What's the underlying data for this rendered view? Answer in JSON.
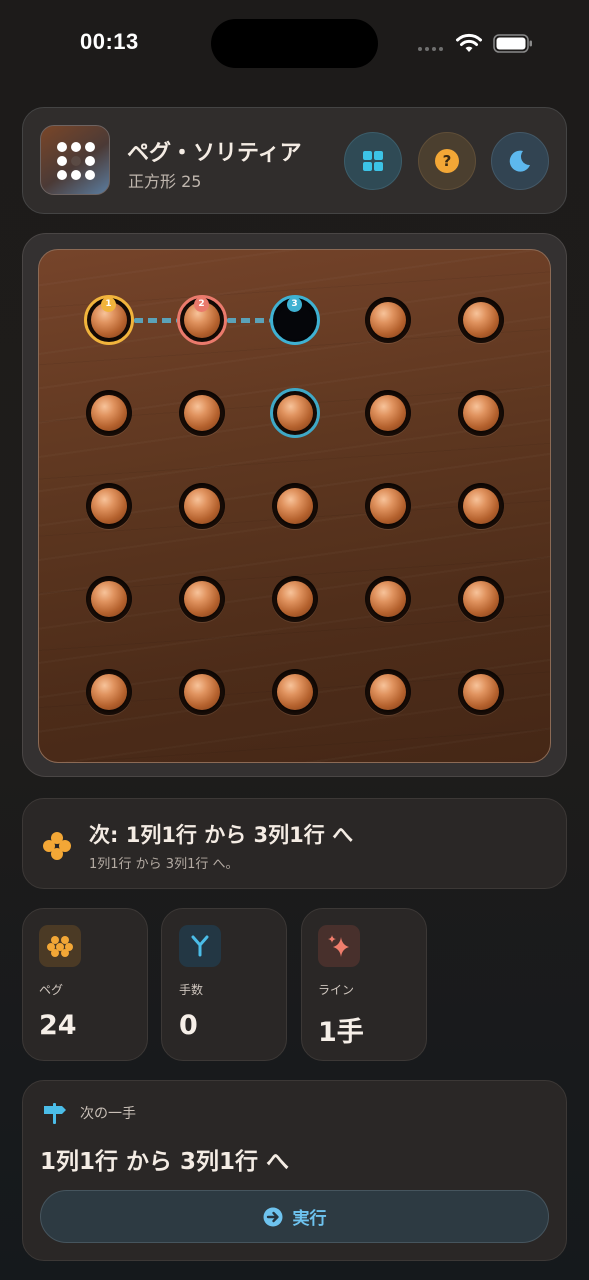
{
  "status_bar": {
    "time": "00:13"
  },
  "header": {
    "title": "ペグ・ソリティア",
    "subtitle": "正方形 25",
    "buttons": [
      {
        "name": "board-select-button",
        "icon": "grid-icon",
        "color": "#3cc3e6"
      },
      {
        "name": "help-button",
        "icon": "question-icon",
        "label": "?",
        "color": "#f3a736"
      },
      {
        "name": "theme-button",
        "icon": "moon-icon",
        "color": "#5db8ee"
      }
    ]
  },
  "board": {
    "rows": 5,
    "cols": 5,
    "cells": [
      [
        "peg",
        "peg",
        "empty",
        "peg",
        "peg"
      ],
      [
        "peg",
        "peg",
        "peg",
        "peg",
        "peg"
      ],
      [
        "peg",
        "peg",
        "peg",
        "peg",
        "peg"
      ],
      [
        "peg",
        "peg",
        "peg",
        "peg",
        "peg"
      ],
      [
        "peg",
        "peg",
        "peg",
        "peg",
        "peg"
      ]
    ],
    "highlights": [
      {
        "row": 1,
        "col": 1,
        "badge": "1",
        "color": "#f1b43c"
      },
      {
        "row": 1,
        "col": 2,
        "badge": "2",
        "color": "#ea7a6c"
      },
      {
        "row": 1,
        "col": 3,
        "badge": "3",
        "color": "#3fb1d2"
      },
      {
        "row": 2,
        "col": 3,
        "badge": "",
        "color": "#3fa8c6"
      }
    ]
  },
  "hint": {
    "title": "次: 1列1行 から 3列1行 へ",
    "subtitle": "1列1行 から 3列1行 へ。",
    "icon": "pegs-cluster-icon",
    "color": "#f3a736"
  },
  "stats": [
    {
      "label": "ペグ",
      "value": "24",
      "icon": "pegs-icon",
      "color": "#f3a736"
    },
    {
      "label": "手数",
      "value": "0",
      "icon": "branch-icon",
      "color": "#4bbde8"
    },
    {
      "label": "ライン",
      "value": "1手",
      "icon": "sparkle-icon",
      "color": "#ef7d6c"
    }
  ],
  "next_move": {
    "label": "次の一手",
    "move": "1列1行 から 3列1行 へ",
    "button_label": "実行",
    "icon": "signpost-icon"
  }
}
